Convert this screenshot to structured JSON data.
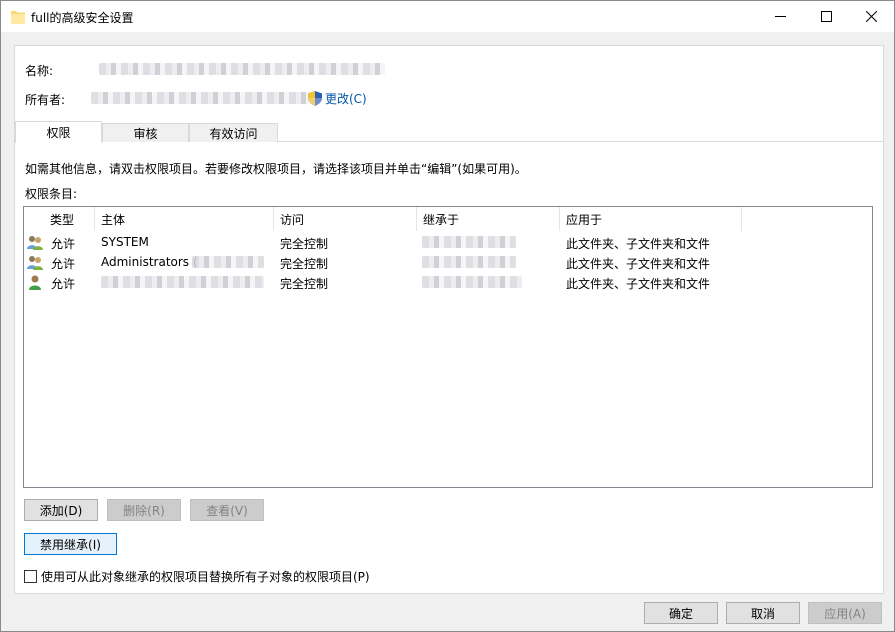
{
  "window": {
    "title": "full的高级安全设置"
  },
  "header": {
    "name_label": "名称:",
    "owner_label": "所有者:",
    "change_link": "更改(C)"
  },
  "tabs": [
    {
      "label": "权限"
    },
    {
      "label": "审核"
    },
    {
      "label": "有效访问"
    }
  ],
  "info_text": "如需其他信息，请双击权限项目。若要修改权限项目，请选择该项目并单击“编辑”(如果可用)。",
  "entries_label": "权限条目:",
  "columns": [
    "类型",
    "主体",
    "访问",
    "继承于",
    "应用于"
  ],
  "rows": [
    {
      "type": "允许",
      "principal": "SYSTEM",
      "access": "完全控制",
      "applies": "此文件夹、子文件夹和文件"
    },
    {
      "type": "允许",
      "principal": "Administrators (",
      "access": "完全控制",
      "applies": "此文件夹、子文件夹和文件"
    },
    {
      "type": "允许",
      "principal": "",
      "access": "完全控制",
      "applies": "此文件夹、子文件夹和文件"
    }
  ],
  "buttons": {
    "add": "添加(D)",
    "remove": "删除(R)",
    "view": "查看(V)",
    "disable_inheritance": "禁用继承(I)",
    "ok": "确定",
    "cancel": "取消",
    "apply": "应用(A)"
  },
  "replace_checkbox_label": "使用可从此对象继承的权限项目替换所有子对象的权限项目(P)",
  "icons": {
    "folder": "folder-icon",
    "shield": "uac-shield-icon",
    "group": "user-group-icon",
    "user": "user-icon"
  }
}
